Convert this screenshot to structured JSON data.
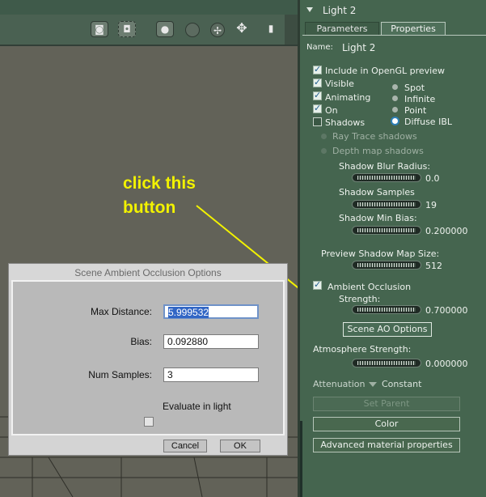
{
  "viewport": {
    "toolbar_icons": [
      "camera-icon",
      "camera-select-icon",
      "render-preview-icon",
      "sphere-icon",
      "rotate-icon",
      "translate-icon",
      "light-icon"
    ]
  },
  "dialog": {
    "title": "Scene Ambient Occlusion Options",
    "max_distance_label": "Max Distance:",
    "max_distance_value": "5.999532",
    "bias_label": "Bias:",
    "bias_value": "0.092880",
    "num_samples_label": "Num Samples:",
    "num_samples_value": "3",
    "evaluate_label": "Evaluate in light",
    "cancel_label": "Cancel",
    "ok_label": "OK"
  },
  "annotation": {
    "line1": "click this",
    "line2": "button",
    "color": "#f2f200"
  },
  "panel": {
    "title": "Light 2",
    "tabs": [
      "Parameters",
      "Properties"
    ],
    "name_label": "Name:",
    "name_value": "Light 2",
    "checkboxes": {
      "opengl": "Include in OpenGL preview",
      "visible": "Visible",
      "animating": "Animating",
      "on": "On",
      "shadows": "Shadows"
    },
    "light_types": [
      "Spot",
      "Infinite",
      "Point",
      "Diffuse IBL"
    ],
    "selected_light_type": "Diffuse IBL",
    "shadow_types": [
      "Ray Trace shadows",
      "Depth map shadows"
    ],
    "shadow_blur_label": "Shadow Blur Radius:",
    "shadow_blur_value": "0.0",
    "shadow_samples_label": "Shadow Samples",
    "shadow_samples_value": "19",
    "shadow_min_bias_label": "Shadow Min Bias:",
    "shadow_min_bias_value": "0.200000",
    "preview_map_label": "Preview Shadow Map Size:",
    "preview_map_value": "512",
    "ambient_occlusion_label": "Ambient Occlusion",
    "strength_label": "Strength:",
    "strength_value": "0.700000",
    "scene_ao_button": "Scene AO Options",
    "atmosphere_label": "Atmosphere Strength:",
    "atmosphere_value": "0.000000",
    "attenuation_label": "Attenuation",
    "attenuation_value": "Constant",
    "set_parent_button": "Set Parent",
    "color_button": "Color",
    "advanced_button": "Advanced material properties",
    "accent": "#45654f"
  }
}
